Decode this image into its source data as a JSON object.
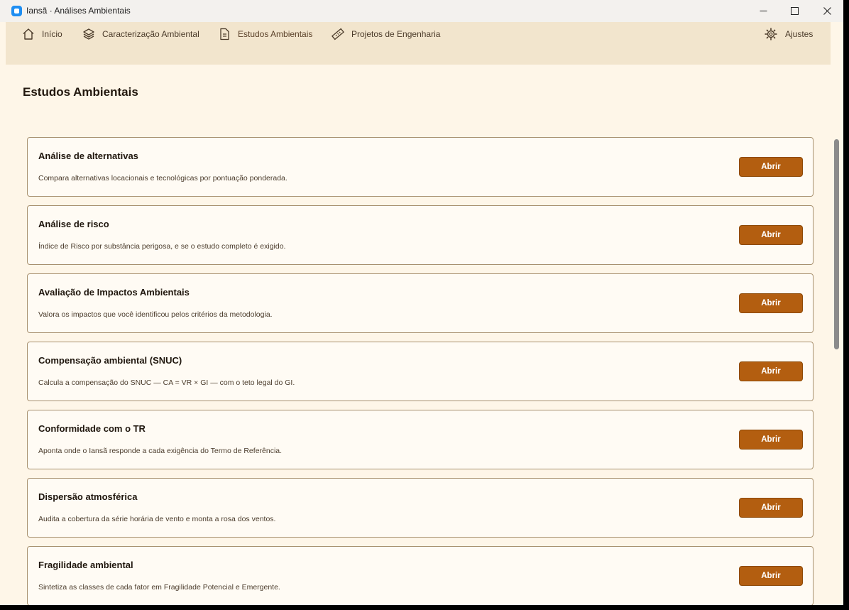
{
  "window": {
    "title": "Iansã · Análises Ambientais"
  },
  "nav": {
    "items": [
      {
        "label": "Início",
        "icon": "home-icon"
      },
      {
        "label": "Caracterização Ambiental",
        "icon": "layers-icon"
      },
      {
        "label": "Estudos Ambientais",
        "icon": "document-icon",
        "active": true
      },
      {
        "label": "Projetos de Engenharia",
        "icon": "ruler-icon"
      }
    ],
    "settings": {
      "label": "Ajustes",
      "icon": "gear-icon"
    }
  },
  "page": {
    "title": "Estudos Ambientais"
  },
  "studies": [
    {
      "title": "Análise de alternativas",
      "description": "Compara alternativas locacionais e tecnológicas por pontuação ponderada.",
      "button": "Abrir"
    },
    {
      "title": "Análise de risco",
      "description": "Índice de Risco por substância perigosa, e se o estudo completo é exigido.",
      "button": "Abrir"
    },
    {
      "title": "Avaliação de Impactos Ambientais",
      "description": "Valora os impactos que você identificou pelos critérios da metodologia.",
      "button": "Abrir"
    },
    {
      "title": "Compensação ambiental (SNUC)",
      "description": "Calcula a compensação do SNUC — CA = VR × GI — com o teto legal do GI.",
      "button": "Abrir"
    },
    {
      "title": "Conformidade com o TR",
      "description": "Aponta onde o Iansã responde a cada exigência do Termo de Referência.",
      "button": "Abrir"
    },
    {
      "title": "Dispersão atmosférica",
      "description": "Audita a cobertura da série horária de vento e monta a rosa dos ventos.",
      "button": "Abrir"
    },
    {
      "title": "Fragilidade ambiental",
      "description": "Sintetiza as classes de cada fator em Fragilidade Potencial e Emergente.",
      "button": "Abrir"
    }
  ],
  "colors": {
    "background": "#fef6e8",
    "nav_background": "#f2e5cd",
    "accent": "#b35e10"
  }
}
